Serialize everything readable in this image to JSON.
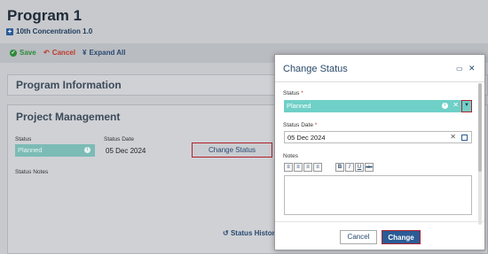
{
  "page": {
    "title": "Program 1",
    "subtitle": "10th Concentration 1.0"
  },
  "toolbar": {
    "save_label": "Save",
    "cancel_label": "Cancel",
    "expand_label": "Expand All"
  },
  "panels": {
    "program_information": "Program Information",
    "project_management": "Project Management"
  },
  "project_management": {
    "status_label": "Status",
    "status_value": "Planned",
    "status_date_label": "Status Date",
    "status_date_value": "05 Dec 2024",
    "change_status_label": "Change Status",
    "status_notes_label": "Status Notes",
    "status_history_label": "Status History"
  },
  "modal": {
    "title": "Change Status",
    "status_label": "Status",
    "status_value": "Planned",
    "status_date_label": "Status Date",
    "status_date_value": "05 Dec 2024",
    "notes_label": "Notes",
    "notes_value": "",
    "cancel_label": "Cancel",
    "change_label": "Change",
    "required_mark": "*"
  },
  "formatting_toolbar": {
    "bold": "B",
    "italic": "I",
    "underline": "U",
    "strike": "abc"
  },
  "colors": {
    "status_teal": "#6fd0c8",
    "primary_blue": "#2a5c96",
    "highlight_red": "#b3202c"
  }
}
